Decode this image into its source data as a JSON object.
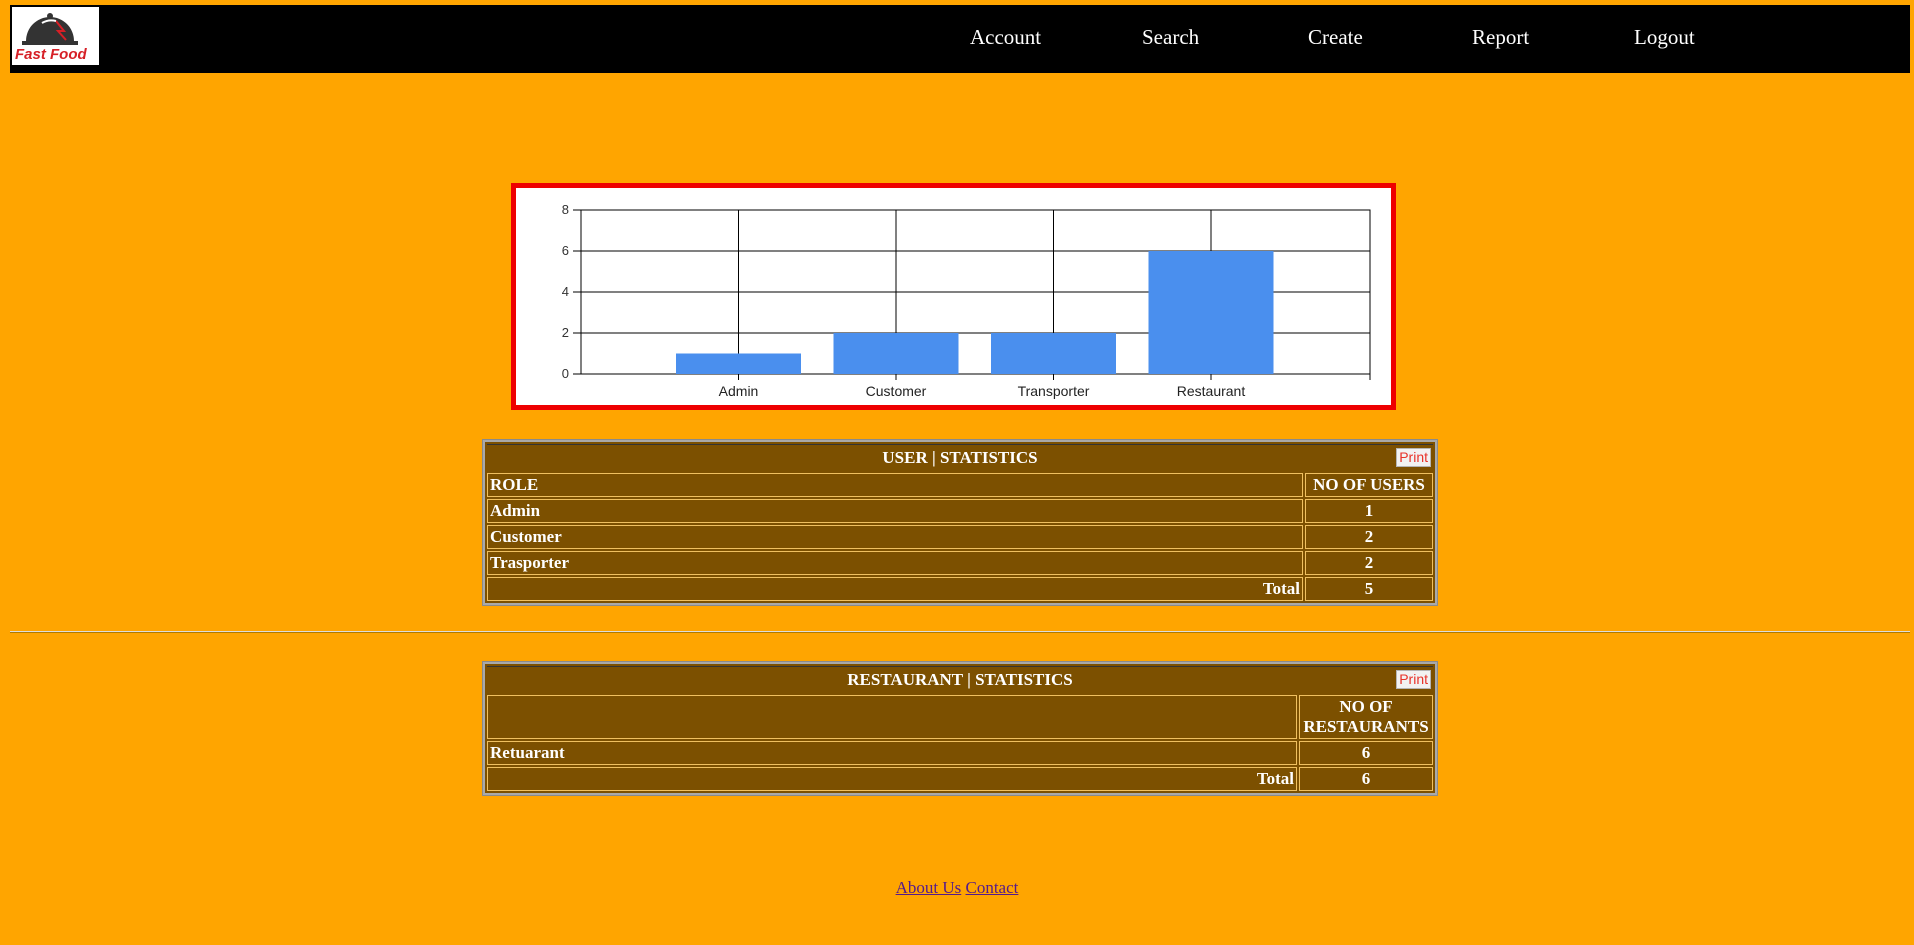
{
  "app": {
    "logo_text": "Fast Food"
  },
  "nav": {
    "items": [
      "Account",
      "Search",
      "Create",
      "Report",
      "Logout"
    ]
  },
  "chart_data": {
    "type": "bar",
    "categories": [
      "Admin",
      "Customer",
      "Transporter",
      "Restaurant"
    ],
    "values": [
      1,
      2,
      2,
      6
    ],
    "title": "",
    "xlabel": "",
    "ylabel": "",
    "ylim": [
      0,
      8
    ],
    "yticks": [
      0,
      2,
      4,
      6,
      8
    ],
    "grid": true,
    "bar_color": "#4a8fee"
  },
  "user_stats": {
    "title": "USER | STATISTICS",
    "print_label": "Print",
    "col_role": "ROLE",
    "col_count": "NO OF USERS",
    "rows": [
      {
        "role": "Admin",
        "count": "1"
      },
      {
        "role": "Customer",
        "count": "2"
      },
      {
        "role": "Trasporter",
        "count": "2"
      }
    ],
    "total_label": "Total",
    "total_value": "5"
  },
  "restaurant_stats": {
    "title": "RESTAURANT | STATISTICS",
    "print_label": "Print",
    "col_name": "",
    "col_count_line1": "NO OF",
    "col_count_line2": "RESTAURANTS",
    "rows": [
      {
        "name": "Retuarant",
        "count": "6"
      }
    ],
    "total_label": "Total",
    "total_value": "6"
  },
  "footer": {
    "about_label": "About Us",
    "contact_label": "Contact"
  },
  "colors": {
    "page_bg": "#FFA500",
    "table_bg": "#7c5000",
    "chart_border": "#ee0000"
  }
}
